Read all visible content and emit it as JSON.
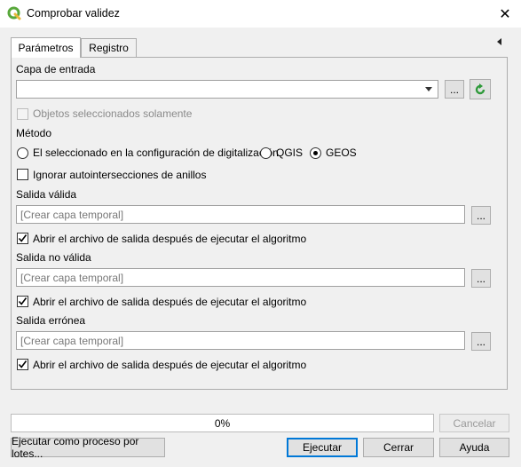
{
  "window": {
    "title": "Comprobar validez",
    "icon": "qgis-icon",
    "close_glyph": "✕"
  },
  "tabs": [
    {
      "label": "Parámetros",
      "active": true
    },
    {
      "label": "Registro",
      "active": false
    }
  ],
  "input_layer": {
    "label": "Capa de entrada",
    "value": "",
    "browse_label": "...",
    "selected_only_label": "Objetos seleccionados solamente",
    "selected_only_checked": false
  },
  "method": {
    "label": "Método",
    "options": [
      {
        "label": "El seleccionado en la configuración de digitalización",
        "selected": false
      },
      {
        "label": "QGIS",
        "selected": false
      },
      {
        "label": "GEOS",
        "selected": true
      }
    ]
  },
  "ignore_ring_self_intersections": {
    "label": "Ignorar autointersecciones de anillos",
    "checked": false
  },
  "outputs": [
    {
      "label": "Salida válida",
      "placeholder": "[Crear capa temporal]",
      "browse_label": "...",
      "open_label": "Abrir el archivo de salida después de ejecutar el algoritmo",
      "open_checked": true
    },
    {
      "label": "Salida no válida",
      "placeholder": "[Crear capa temporal]",
      "browse_label": "...",
      "open_label": "Abrir el archivo de salida después de ejecutar el algoritmo",
      "open_checked": true
    },
    {
      "label": "Salida errónea",
      "placeholder": "[Crear capa temporal]",
      "browse_label": "...",
      "open_label": "Abrir el archivo de salida después de ejecutar el algoritmo",
      "open_checked": true
    }
  ],
  "progress": {
    "text": "0%",
    "value": 0
  },
  "buttons": {
    "cancel": "Cancelar",
    "batch": "Ejecutar como proceso por lotes...",
    "run": "Ejecutar",
    "close": "Cerrar",
    "help": "Ayuda"
  },
  "colors": {
    "accent": "#0078d7",
    "qgis_green": "#3f9e2f",
    "refresh_green": "#2e9a3a"
  }
}
